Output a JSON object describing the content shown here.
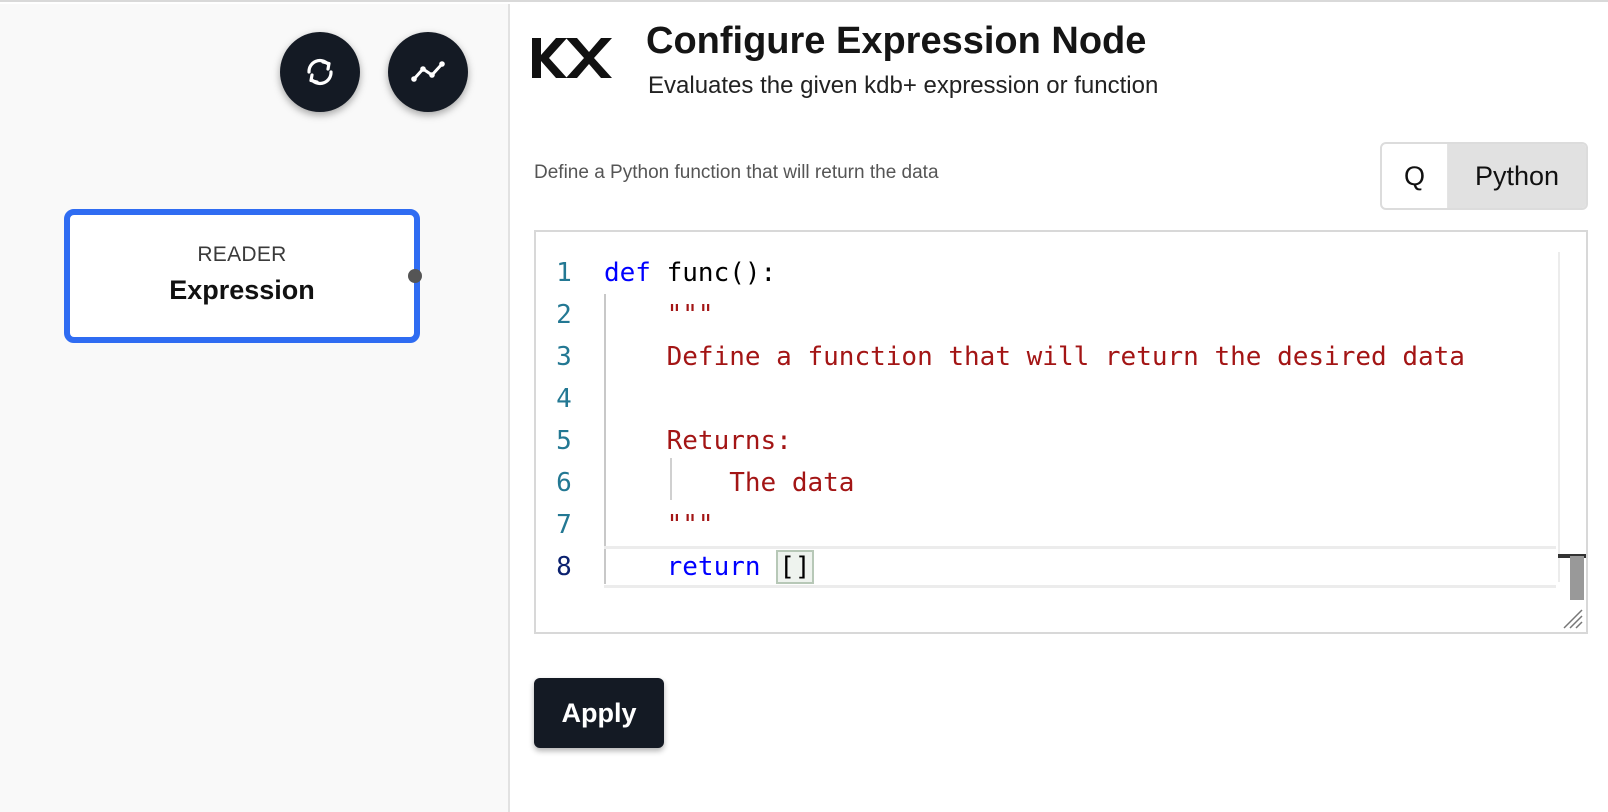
{
  "canvas": {
    "node": {
      "type": "READER",
      "name": "Expression"
    },
    "icons": {
      "refresh": "refresh-icon",
      "chart": "line-chart-icon"
    }
  },
  "panel": {
    "logo": "KX",
    "title": "Configure Expression Node",
    "subtitle": "Evaluates the given kdb+ expression or function",
    "helper": "Define a Python function that will return the data",
    "language": {
      "options": [
        "Q",
        "Python"
      ],
      "selected": "Python"
    },
    "editor": {
      "line_numbers": [
        "1",
        "2",
        "3",
        "4",
        "5",
        "6",
        "7",
        "8"
      ],
      "lines": [
        {
          "kw": "def",
          "rest": " func():"
        },
        {
          "str": "    \"\"\""
        },
        {
          "str": "    Define a function that will return the desired data"
        },
        {
          "str": ""
        },
        {
          "str": "    Returns:"
        },
        {
          "str": "        The data"
        },
        {
          "str": "    \"\"\""
        },
        {
          "indent": "    ",
          "kw": "return",
          "rest": " ",
          "bracket": "[]"
        }
      ]
    },
    "apply_label": "Apply"
  },
  "colors": {
    "node_border": "#2f6cf2",
    "dark_button": "#141a24",
    "keyword": "#0000ff",
    "string": "#a31515",
    "line_number": "#237893"
  }
}
